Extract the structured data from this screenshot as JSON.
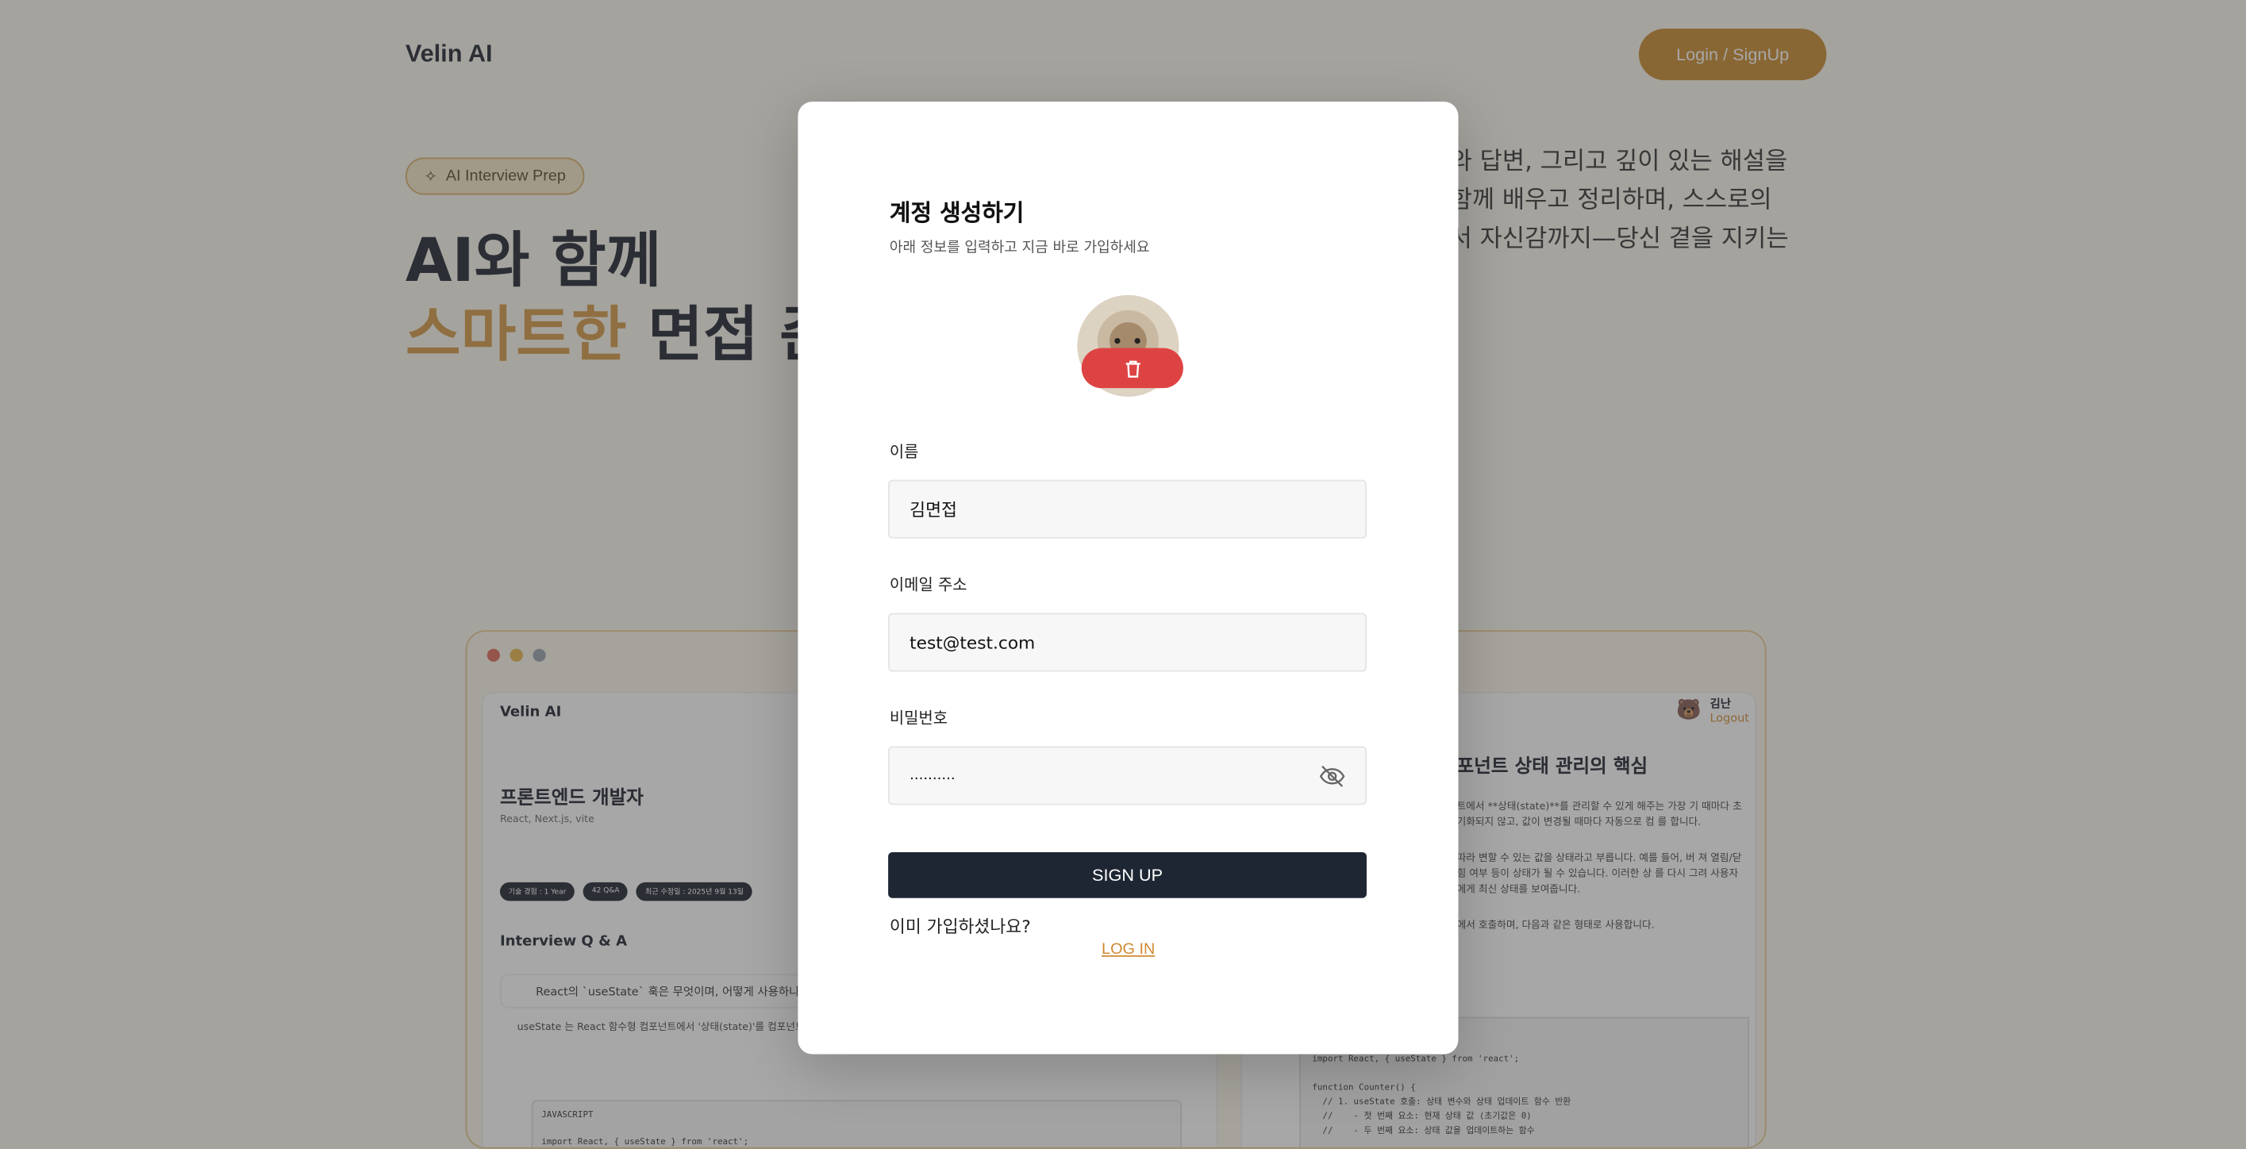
{
  "header": {
    "logo": "Velin AI",
    "login_button": "Login / SignUp"
  },
  "hero": {
    "chip": "AI Interview Prep",
    "line1": "AI와 함께",
    "line2_accent": "스마트한",
    "line2_rest": " 면접 준",
    "right_text": "와 답변, 그리고 깊이 있는 해설을\n함께 배우고 정리하며, 스스로의\n서 자신감까지—당신 곁을 지키는"
  },
  "mockup": {
    "logo": "Velin AI",
    "title": "프론트엔드 개발자",
    "subtitle": "React, Next.js, vite",
    "tags": [
      "기술 경험 : 1 Year",
      "42 Q&A",
      "최근 수정일 : 2025년 9월 13일"
    ],
    "section": "Interview Q & A",
    "question": "React의 `useState` 훅은 무엇이며, 어떻게 사용하나요?",
    "answer": "useState 는 React 함수형 컴포넌트에서 '상태(state)'를 컴포넌트의 데이터라고 생각하시면 돼요. useState 는 수 있는 함수입니다. 이렇게 사용합니다.",
    "code_lang": "JAVASCRIPT",
    "code_line": "import React, { useState } from 'react';",
    "user_name": "김난",
    "user_logout": "Logout",
    "right_title": "포넌트 상태 관리의 핵심",
    "right_text1": "트에서 **상태(state)**를 관리할 수 있게 해주는 가장 기 때마다 초기화되지 않고, 값이 변경될 때마다 자동으로 컴 를 합니다.",
    "right_text2": "따라 변할 수 있는 값을 상태라고 부릅니다. 예를 들어, 버 져 열림/닫힘 여부 등이 상태가 될 수 있습니다. 이러한 상 를 다시 그려 사용자에게 최신 상태를 보여줍니다.",
    "right_text3": "에서 호출하며, 다음과 같은 형태로 사용합니다.",
    "right_code": "import React, { useState } from 'react';\n\nfunction Counter() {\n  // 1. useState 호출: 상태 변수와 상태 업데이트 함수 반환\n  //    - 첫 번째 요소: 현재 상태 값 (초기값은 0)\n  //    - 두 번째 요소: 상태 값을 업데이트하는 함수"
  },
  "modal": {
    "title": "계정 생성하기",
    "subtitle": "아래 정보를 입력하고 지금 바로 가입하세요",
    "name_label": "이름",
    "name_value": "김면접",
    "email_label": "이메일 주소",
    "email_value": "test@test.com",
    "password_label": "비밀번호",
    "password_value": "..........",
    "signup_button": "SIGN UP",
    "already_text": "이미 가입하셨나요?",
    "login_link": "LOG IN"
  },
  "colors": {
    "accent": "#c98a2e",
    "dark_button": "#1f2633",
    "delete_button": "#de4343"
  }
}
